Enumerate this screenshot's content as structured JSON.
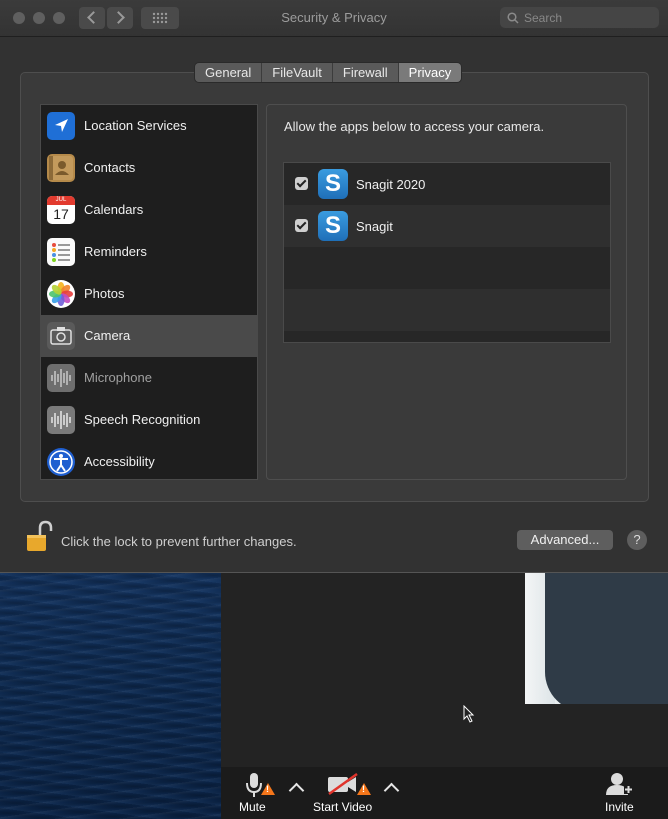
{
  "window": {
    "title": "Security & Privacy",
    "search_placeholder": "Search"
  },
  "tabs": [
    {
      "label": "General"
    },
    {
      "label": "FileVault"
    },
    {
      "label": "Firewall"
    },
    {
      "label": "Privacy",
      "active": true
    }
  ],
  "sidebar": {
    "items": [
      {
        "label": "Location Services",
        "icon": "location-arrow-icon"
      },
      {
        "label": "Contacts",
        "icon": "contacts-book-icon"
      },
      {
        "label": "Calendars",
        "icon": "calendar-icon",
        "icon_month": "JUL",
        "icon_day": "17"
      },
      {
        "label": "Reminders",
        "icon": "reminders-list-icon"
      },
      {
        "label": "Photos",
        "icon": "photos-flower-icon"
      },
      {
        "label": "Camera",
        "icon": "camera-icon",
        "selected": true
      },
      {
        "label": "Microphone",
        "icon": "microphone-waveform-icon",
        "dimmed": true
      },
      {
        "label": "Speech Recognition",
        "icon": "speech-waveform-icon"
      },
      {
        "label": "Accessibility",
        "icon": "accessibility-icon"
      }
    ]
  },
  "camera_panel": {
    "description": "Allow the apps below to access your camera.",
    "apps": [
      {
        "name": "Snagit 2020",
        "checked": true,
        "icon": "snagit-icon",
        "icon_letter": "S"
      },
      {
        "name": "Snagit",
        "checked": true,
        "icon": "snagit-icon",
        "icon_letter": "S"
      }
    ]
  },
  "footer": {
    "lock_text": "Click the lock to prevent further changes.",
    "advanced_label": "Advanced...",
    "help_label": "?"
  },
  "zoom_toolbar": {
    "mute_label": "Mute",
    "start_video_label": "Start Video",
    "invite_label": "Invite"
  },
  "colors": {
    "accent_blue": "#2f8ae0",
    "warning_orange": "#f5761a",
    "lock_gold": "#e8a82c"
  }
}
